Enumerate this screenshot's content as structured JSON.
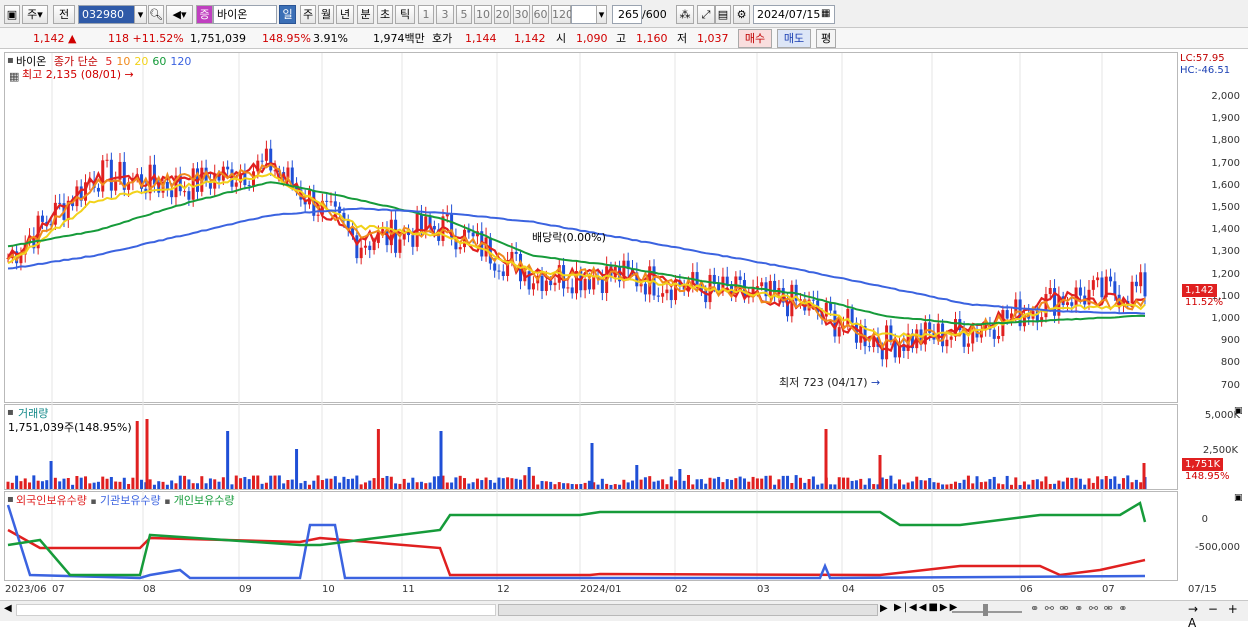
{
  "toolbar": {
    "market_type": "주",
    "sector_btn": "전",
    "code": "032980",
    "name_prefix": "증",
    "stock_name": "바이온",
    "periods": [
      "일",
      "주",
      "월",
      "년",
      "분",
      "초",
      "틱"
    ],
    "intervals": [
      "1",
      "3",
      "5",
      "10",
      "20",
      "30",
      "60",
      "120"
    ],
    "count": "265",
    "max": "/600",
    "date": "2024/07/15"
  },
  "quote": {
    "price": "1,142",
    "change": "118",
    "change_pct": "+11.52%",
    "volume": "1,751,039",
    "volume_ratio": "148.95%",
    "turnover": "3.91%",
    "amount": "1,974백만",
    "bid_label": "호가",
    "bid1": "1,144",
    "bid2": "1,142",
    "open_label": "시",
    "open": "1,090",
    "high_label": "고",
    "high": "1,160",
    "low_label": "저",
    "low": "1,037",
    "buy_btn": "매수",
    "sell_btn": "매도",
    "eval_btn": "평"
  },
  "price_pane": {
    "name": "바이온",
    "legend_prefix": "종가 단순",
    "ma": [
      {
        "period": "5",
        "color": "#e02020"
      },
      {
        "period": "10",
        "color": "#f08a1c"
      },
      {
        "period": "20",
        "color": "#f2d21a"
      },
      {
        "period": "60",
        "color": "#169b3a"
      },
      {
        "period": "120",
        "color": "#3b63e0"
      }
    ],
    "high_note": "최고 2,135 (08/01)",
    "low_note": "최저 723 (04/17)",
    "dividend_note": "배당락(0.00%)",
    "lc": "LC:57.95",
    "hc": "HC:-46.51",
    "price_tag": "1,142",
    "pct_tag": "11.52%",
    "yticks": [
      "2,000",
      "1,900",
      "1,800",
      "1,700",
      "1,600",
      "1,500",
      "1,400",
      "1,300",
      "1,200",
      "1,100",
      "1,000",
      "900",
      "800",
      "700"
    ]
  },
  "volume_pane": {
    "title": "거래량",
    "value": "1,751,039주(148.95%)",
    "yticks": [
      "5,000K",
      "2,500K"
    ],
    "tag": "1,751K",
    "tag_pct": "148.95%"
  },
  "holding_pane": {
    "legend": [
      "외국인보유수량",
      "기관보유수량",
      "개인보유수량"
    ],
    "colors": [
      "#e02020",
      "#3b63e0",
      "#169b3a"
    ],
    "yticks": [
      "0",
      "-500,000"
    ]
  },
  "xaxis": [
    "2023/06",
    "07",
    "08",
    "09",
    "10",
    "11",
    "12",
    "2024/01",
    "02",
    "03",
    "04",
    "05",
    "06",
    "07",
    "07/15"
  ],
  "chart_data": {
    "type": "candlestick",
    "x": [
      "2023/06",
      "2023/07",
      "2023/08",
      "2023/09",
      "2023/10",
      "2023/11",
      "2023/12",
      "2024/01",
      "2024/02",
      "2024/03",
      "2024/04",
      "2024/05",
      "2024/06",
      "2024/07"
    ],
    "close": [
      1280,
      1650,
      1600,
      1700,
      1350,
      1420,
      1200,
      1200,
      1140,
      1080,
      900,
      950,
      1100,
      1142
    ],
    "ylim": [
      700,
      2100
    ],
    "series": [
      {
        "name": "5",
        "values": [
          1270,
          1640,
          1620,
          1690,
          1360,
          1410,
          1200,
          1210,
          1140,
          1080,
          880,
          960,
          1100,
          1080
        ]
      },
      {
        "name": "10",
        "values": [
          1260,
          1600,
          1630,
          1680,
          1390,
          1400,
          1210,
          1200,
          1140,
          1090,
          900,
          950,
          1080,
          1075
        ]
      },
      {
        "name": "20",
        "values": [
          1250,
          1540,
          1600,
          1650,
          1420,
          1380,
          1220,
          1190,
          1140,
          1100,
          930,
          940,
          1060,
          1060
        ]
      },
      {
        "name": "60",
        "values": [
          1330,
          1400,
          1520,
          1620,
          1540,
          1450,
          1290,
          1240,
          1170,
          1120,
          1020,
          980,
          1000,
          1020
        ]
      },
      {
        "name": "120",
        "values": [
          1230,
          1290,
          1380,
          1470,
          1500,
          1480,
          1440,
          1370,
          1300,
          1230,
          1150,
          1070,
          1040,
          1030
        ]
      }
    ]
  }
}
